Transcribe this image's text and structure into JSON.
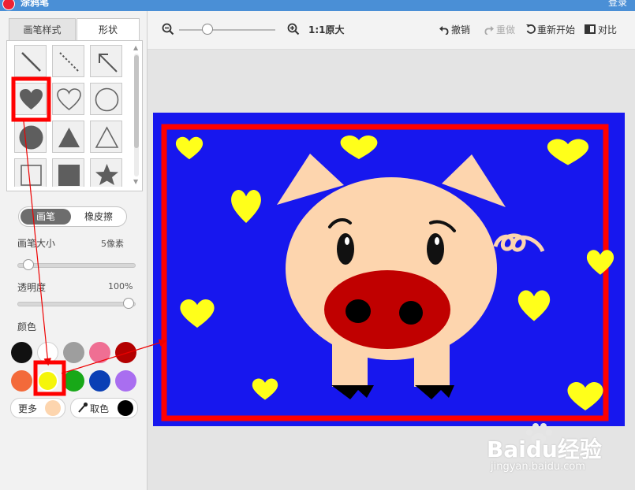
{
  "window": {
    "title": "涂鸦笔",
    "login": "登录"
  },
  "tabs": [
    {
      "label": "画笔样式"
    },
    {
      "label": "形状"
    }
  ],
  "shapes": {
    "items": [
      "line",
      "dashed-line",
      "arrow",
      "heart-filled",
      "heart-outline",
      "circle-outline",
      "circle-filled",
      "triangle-filled",
      "triangle-outline",
      "square-outline",
      "square-filled",
      "star-filled"
    ],
    "selected": "heart-filled"
  },
  "tool": {
    "pen_label": "画笔",
    "eraser_label": "橡皮擦",
    "active": "pen"
  },
  "brush_size": {
    "label": "画笔大小",
    "value_text": "5像素"
  },
  "opacity": {
    "label": "透明度",
    "value_text": "100%",
    "value": 1.0
  },
  "color": {
    "label": "颜色",
    "swatches": [
      "#111111",
      "#ffffff",
      "#9e9e9e",
      "#ef6f93",
      "#b30000",
      "#f36a3a",
      "#f5f50a",
      "#18a818",
      "#0a3fb5",
      "#a96ef0"
    ],
    "selected": "#f5f50a",
    "more_label": "更多",
    "more_color": "#fdd5ae",
    "picker_label": "取色",
    "picker_color": "#000000"
  },
  "toolbar": {
    "zoom_text": "1:1原大",
    "undo_label": "撤销",
    "redo_label": "重做",
    "restart_label": "重新开始",
    "compare_label": "对比"
  },
  "canvas": {
    "background": "#1717ee",
    "frame_color": "#ff0000"
  },
  "watermark": {
    "brand": "Baidu经验",
    "url": "jingyan.baidu.com"
  }
}
